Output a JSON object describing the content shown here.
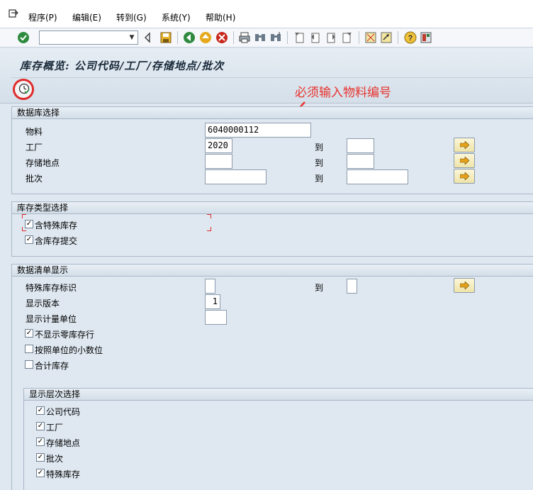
{
  "menu": {
    "items": [
      "程序(P)",
      "编辑(E)",
      "转到(G)",
      "系统(Y)",
      "帮助(H)"
    ]
  },
  "toolbar": {
    "command_value": "",
    "icons": [
      "check-icon",
      "save-icon",
      "back-icon",
      "exit-icon",
      "cancel-icon",
      "print-icon",
      "find-icon",
      "find-next-icon",
      "first-page-icon",
      "prev-page-icon",
      "next-page-icon",
      "last-page-icon",
      "create-session-icon",
      "shortcut-icon",
      "help-icon",
      "layout-icon"
    ]
  },
  "title": "库存概览: 公司代码/工厂/存储地点/批次",
  "annotation": "必须输入物料编号",
  "db_select": {
    "header": "数据库选择",
    "material_label": "物料",
    "material_value": "6040000112",
    "plant_label": "工厂",
    "plant_value": "2020",
    "storage_label": "存储地点",
    "storage_value": "",
    "batch_label": "批次",
    "batch_value": "",
    "to_label": "到"
  },
  "stock_type": {
    "header": "库存类型选择",
    "special_label": "含特殊库存",
    "special_checked": true,
    "commit_label": "含库存提交",
    "commit_checked": true
  },
  "list_display": {
    "header": "数据清单显示",
    "special_id_label": "特殊库存标识",
    "to_label": "到",
    "version_label": "显示版本",
    "version_value": "1",
    "uom_label": "显示计量单位",
    "no_zero_label": "不显示零库存行",
    "no_zero_checked": true,
    "decimals_label": "按照单位的小数位",
    "decimals_checked": false,
    "total_label": "合计库存",
    "total_checked": false
  },
  "hierarchy": {
    "header": "显示层次选择",
    "items": [
      {
        "label": "公司代码",
        "checked": true
      },
      {
        "label": "工厂",
        "checked": true
      },
      {
        "label": "存储地点",
        "checked": true
      },
      {
        "label": "批次",
        "checked": true
      },
      {
        "label": "特殊库存",
        "checked": true
      }
    ]
  }
}
